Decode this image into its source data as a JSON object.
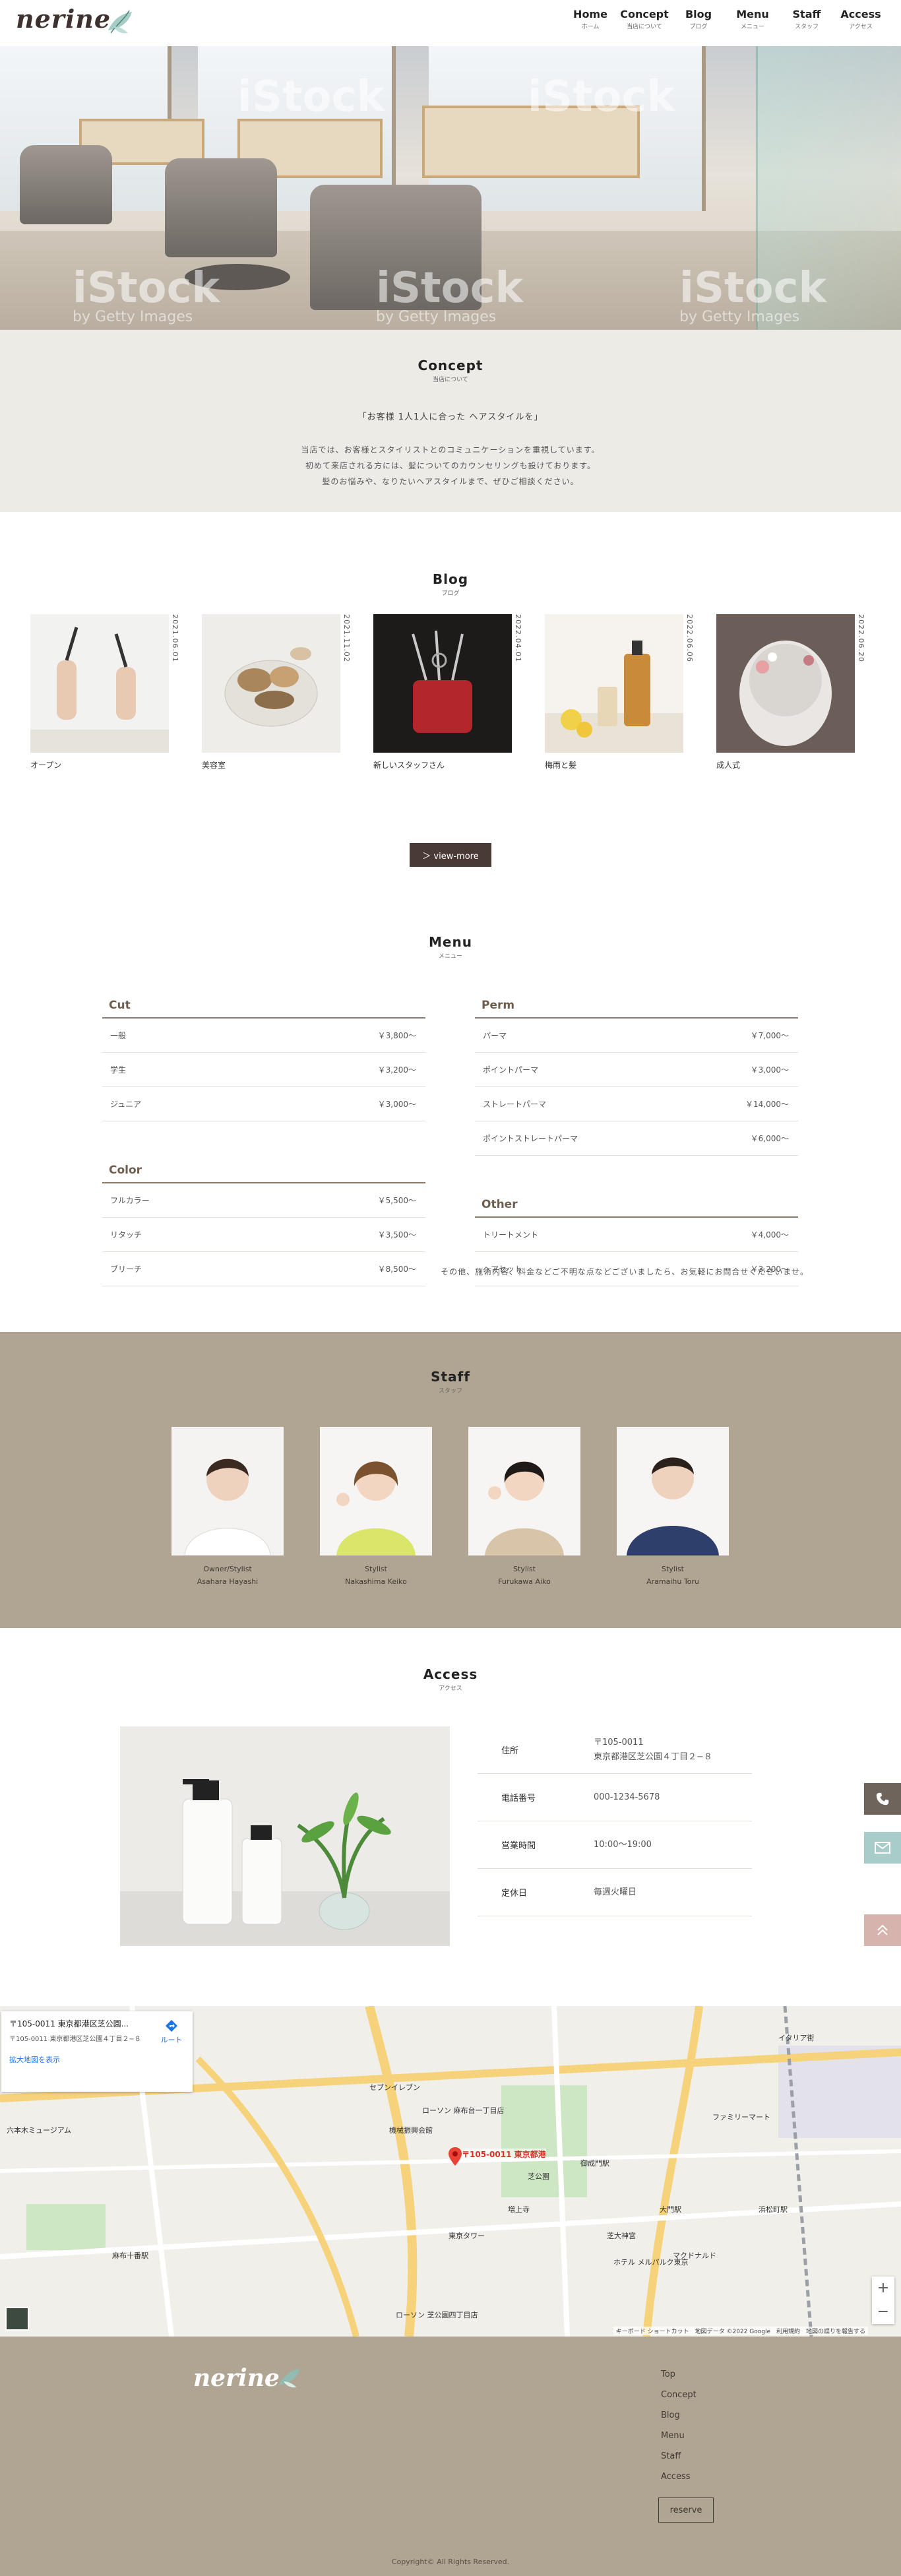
{
  "header": {
    "logo": "nerine",
    "nav": [
      {
        "en": "Home",
        "ja": "ホーム"
      },
      {
        "en": "Concept",
        "ja": "当店について"
      },
      {
        "en": "Blog",
        "ja": "ブログ"
      },
      {
        "en": "Menu",
        "ja": "メニュー"
      },
      {
        "en": "Staff",
        "ja": "スタッフ"
      },
      {
        "en": "Access",
        "ja": "アクセス"
      }
    ]
  },
  "hero": {
    "watermark": "iStock",
    "watermark_sub": "by Getty Images"
  },
  "concept": {
    "title": "Concept",
    "title_ja": "当店について",
    "lead": "「お客様 1人1人に合った ヘアスタイルを」",
    "body": [
      "当店では、お客様とスタイリストとのコミュニケーションを重視しています。",
      "初めて来店される方には、髪についてのカウンセリングも設けております。",
      "髪のお悩みや、なりたいヘアスタイルまで、ぜひご相談ください。"
    ]
  },
  "blog": {
    "title": "Blog",
    "title_ja": "ブログ",
    "posts": [
      {
        "date": "2021.06.01",
        "title": "オープン"
      },
      {
        "date": "2021.11.02",
        "title": "美容室"
      },
      {
        "date": "2022.04.01",
        "title": "新しいスタッフさん"
      },
      {
        "date": "2022.06.06",
        "title": "梅雨と髪"
      },
      {
        "date": "2022.06.20",
        "title": "成人式"
      }
    ],
    "view_more": "＞ view-more"
  },
  "menu": {
    "title": "Menu",
    "title_ja": "メニュー",
    "categories": {
      "cut": {
        "name": "Cut",
        "items": [
          {
            "name": "一般",
            "price": "￥3,800～"
          },
          {
            "name": "学生",
            "price": "￥3,200～"
          },
          {
            "name": "ジュニア",
            "price": "￥3,000～"
          }
        ]
      },
      "color": {
        "name": "Color",
        "items": [
          {
            "name": "フルカラー",
            "price": "￥5,500～"
          },
          {
            "name": "リタッチ",
            "price": "￥3,500～"
          },
          {
            "name": "ブリーチ",
            "price": "￥8,500～"
          }
        ]
      },
      "perm": {
        "name": "Perm",
        "items": [
          {
            "name": "パーマ",
            "price": "￥7,000～"
          },
          {
            "name": "ポイントパーマ",
            "price": "￥3,000～"
          },
          {
            "name": "ストレートパーマ",
            "price": "￥14,000～"
          },
          {
            "name": "ポイントストレートパーマ",
            "price": "￥6,000～"
          }
        ]
      },
      "other": {
        "name": "Other",
        "items": [
          {
            "name": "トリートメント",
            "price": "￥4,000～"
          },
          {
            "name": "ヘアセット",
            "price": "￥3,200～"
          }
        ]
      }
    },
    "note": "その他、施術内容、料金などご不明な点などございましたら、お気軽にお問合せくださいませ。"
  },
  "staff": {
    "title": "Staff",
    "title_ja": "スタッフ",
    "members": [
      {
        "role": "Owner/Stylist",
        "name": "Asahara Hayashi",
        "shirt": "#ffffff",
        "hair": "#3b2a22"
      },
      {
        "role": "Stylist",
        "name": "Nakashima Keiko",
        "shirt": "#d9e66a",
        "hair": "#7a5230"
      },
      {
        "role": "Stylist",
        "name": "Furukawa Aiko",
        "shirt": "#d8c4a8",
        "hair": "#1f1a18"
      },
      {
        "role": "Stylist",
        "name": "Aramaihu Toru",
        "shirt": "#2f3f6b",
        "hair": "#2a211c"
      }
    ]
  },
  "access": {
    "title": "Access",
    "title_ja": "アクセス",
    "rows": [
      {
        "label": "住所",
        "value1": "〒105-0011",
        "value2": "東京都港区芝公園４丁目２−８"
      },
      {
        "label": "電話番号",
        "value1": "000-1234-5678",
        "value2": ""
      },
      {
        "label": "営業時間",
        "value1": "10:00〜19:00",
        "value2": ""
      },
      {
        "label": "定休日",
        "value1": "毎週火曜日",
        "value2": ""
      }
    ]
  },
  "map": {
    "card_title": "〒105-0011 東京都港区芝公園...",
    "card_addr": "〒105-0011 東京都港区芝公園４丁目２−８",
    "card_link": "拡大地図を表示",
    "route": "ルート",
    "pin_label": "〒105-0011 東京都港",
    "zoom_in": "+",
    "zoom_out": "−",
    "attribution": "キーボード ショートカット　地図データ ©2022 Google　利用規約　地図の誤りを報告する",
    "labels": [
      "ローソン 麻布台一丁目店",
      "機械振興会館",
      "東京タワー",
      "芝公園",
      "増上寺",
      "御成門駅",
      "大門駅",
      "浜松町駅",
      "芝大神宮",
      "六本木ミュージアム",
      "麻布十番駅",
      "セブンイレブン",
      "ファミリーマート",
      "イタリア街",
      "マクドナルド",
      "ホテル メルパルク東京",
      "ローソン 芝公園四丁目店"
    ]
  },
  "footer": {
    "logo": "nerine",
    "links": [
      "Top",
      "Concept",
      "Blog",
      "Menu",
      "Staff",
      "Access"
    ],
    "reserve": "reserve",
    "copyright": "Copyright© All Rights Reserved."
  },
  "side_buttons": {
    "phone_color": "#6f645b",
    "mail_color": "#a8ccc9",
    "top_color": "#d7b3ad"
  },
  "colors": {
    "accent": "#b0a493",
    "dark": "#4a3a36",
    "concept_bg": "#edebe5"
  }
}
